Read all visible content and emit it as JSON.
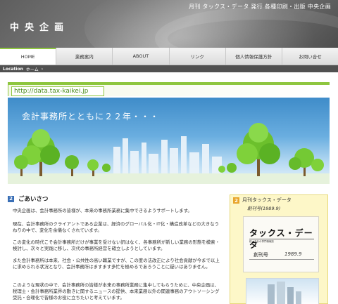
{
  "header": {
    "tagline": "月刊 タックス・データ 発行 各種印刷・出版 中央企画",
    "title": "中央企画"
  },
  "nav": {
    "items": [
      {
        "label": "HOME",
        "active": true
      },
      {
        "label": "業務案内",
        "active": false
      },
      {
        "label": "ABOUT",
        "active": false
      },
      {
        "label": "リンク",
        "active": false
      },
      {
        "label": "個人情報保護方針",
        "active": false
      },
      {
        "label": "お問い合せ",
        "active": false
      }
    ]
  },
  "location": {
    "label": "Location",
    "crumb": "ホーム",
    "arrow": "›"
  },
  "url_bar": {
    "text": "http://data.tax-kaikei.jp",
    "accent": "#8ec63f"
  },
  "banner": {
    "text": "会計事務所とともに２２年・・・"
  },
  "main": {
    "section_number": "2",
    "section_title": "ごあいさつ",
    "paragraphs": [
      "中央企画は、会計事務所の皆様が、本来の事務所業務に集中できるようサポートします。",
      "現在、会計事務所のクライアントである企業は、経済のグローバル化・IT化・構造改革などの大きなうねりの中で、変化を余儀なくされています。",
      "この変化の時代こそ会計事務所だけが事業を受けない訳はなく、各事務所が新しい業務の形態を模索・検討し、次々と実践に移し、次代の事務所経営を確立しようとしています。",
      "また会計事務所は本来、社会・公共性の高い職業ですが、この度の法改正により社会貢献が今まで以上に求められる状況となり、会計事務所はますます多忙を極めるであろうことに疑いはありません。",
      "このような現状の中で、会計事務所の皆様が本来の事務所業務に集中してもらうために、中央企画は、税理士・会計事務所業界の動きに関するニュースの提供、本来業務以外の関連事務のアウトソーシング受託・合理化で皆様のお役に立ちたいと考えています。"
    ]
  },
  "sidebar": {
    "number": "2",
    "title": "月刊タックス・データ",
    "subtitle": "創刊号(1989.9)",
    "cover_logo": "タックス・データ",
    "cover_small": "税・会計の専門情報誌",
    "cover_issue": "創刊号",
    "cover_date": "1989.9"
  }
}
